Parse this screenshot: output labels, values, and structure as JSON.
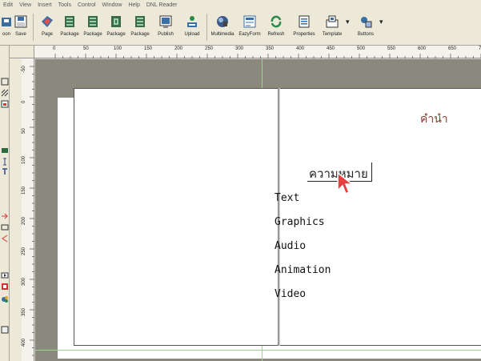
{
  "menu": [
    "Edit",
    "View",
    "Insert",
    "Tools",
    "Control",
    "Window",
    "Help",
    "DNL Reader"
  ],
  "toolbar": {
    "buttons": [
      {
        "label": "oon",
        "icon": "open-icon"
      },
      {
        "label": "Save",
        "icon": "save-icon"
      },
      {
        "label": "Page",
        "icon": "page-icon"
      },
      {
        "label": "Package",
        "icon": "package-icon"
      },
      {
        "label": "Package",
        "icon": "package-icon"
      },
      {
        "label": "Package",
        "icon": "package-icon"
      },
      {
        "label": "Package",
        "icon": "package-icon"
      },
      {
        "label": "Publish",
        "icon": "publish-icon"
      },
      {
        "label": "Upload",
        "icon": "upload-icon"
      },
      {
        "label": "Multimedia",
        "icon": "multimedia-icon"
      },
      {
        "label": "EazyForm",
        "icon": "form-icon"
      },
      {
        "label": "Refresh",
        "icon": "refresh-icon"
      },
      {
        "label": "Properties",
        "icon": "properties-icon"
      },
      {
        "label": "Template",
        "icon": "template-icon"
      },
      {
        "label": "Buttons",
        "icon": "buttons-icon"
      }
    ]
  },
  "ruler": {
    "h_ticks": [
      "0",
      "50",
      "100",
      "150",
      "200",
      "250",
      "300",
      "350",
      "400",
      "450",
      "500",
      "550",
      "600",
      "650",
      "700"
    ],
    "v_ticks": [
      "-50",
      "0",
      "50",
      "100",
      "150",
      "200",
      "250",
      "300",
      "350",
      "400",
      "450"
    ]
  },
  "page": {
    "title": "คำนำ",
    "heading": "ความหมาย",
    "items": [
      "Text",
      "Graphics",
      "Audio",
      "Animation",
      "Video"
    ]
  },
  "colors": {
    "title": "#8b3a2f",
    "canvas": "#8b897e",
    "guide": "#9bd48f"
  }
}
